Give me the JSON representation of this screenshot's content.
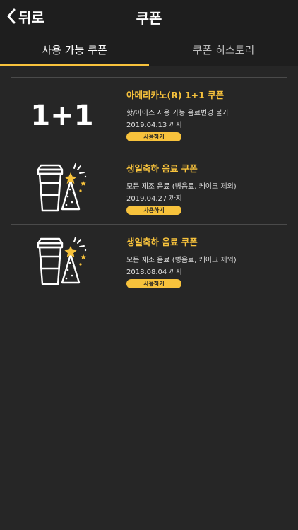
{
  "header": {
    "back_label": "뒤로",
    "title": "쿠폰"
  },
  "tabs": [
    {
      "label": "사용 가능 쿠폰",
      "active": true
    },
    {
      "label": "쿠폰 히스토리",
      "active": false
    }
  ],
  "accent_color": "#f7c23c",
  "coupons": [
    {
      "icon": "one-plus-one-icon",
      "icon_text": "1+1",
      "title": "아메리카노(R) 1+1 쿠폰",
      "description": "핫/아이스 사용 가능 음료변경 불가",
      "expiry": "2019.04.13 까지",
      "button_label": "사용하기"
    },
    {
      "icon": "birthday-drink-icon",
      "title": "생일축하 음료 쿠폰",
      "description": "모든 제조 음료 (병음료, 케이크 제외)",
      "expiry": "2019.04.27 까지",
      "button_label": "사용하기"
    },
    {
      "icon": "birthday-drink-icon",
      "title": "생일축하 음료 쿠폰",
      "description": "모든 제조 음료 (병음료, 케이크 제외)",
      "expiry": "2018.08.04 까지",
      "button_label": "사용하기"
    }
  ]
}
